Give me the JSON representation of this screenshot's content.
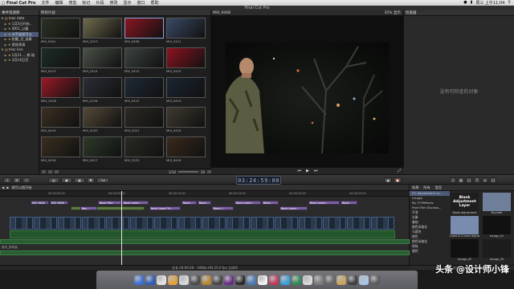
{
  "menubar": {
    "app_name": "Final Cut Pro",
    "items": [
      "文件",
      "编辑",
      "修剪",
      "标记",
      "片段",
      "修改",
      "显示",
      "窗口",
      "帮助"
    ],
    "clock": "周三 上午11:04"
  },
  "window_title": "Final Cut Pro",
  "libraries": {
    "header": "事件资源库",
    "items": [
      {
        "label": "mac data",
        "indent": 0,
        "selected": false
      },
      {
        "label": "1月5日开始...",
        "indent": 1,
        "selected": false
      },
      {
        "label": "IDO1_以看",
        "indent": 1,
        "selected": false
      },
      {
        "label": "对不起就可以",
        "indent": 1,
        "selected": true
      },
      {
        "label": "拍摄_活_准素",
        "indent": 1,
        "selected": false
      },
      {
        "label": "直接表演",
        "indent": 1,
        "selected": false
      },
      {
        "label": "mac lion",
        "indent": 0,
        "selected": false
      },
      {
        "label": "1月21..., 都 碰",
        "indent": 1,
        "selected": false
      },
      {
        "label": "3月14日活",
        "indent": 1,
        "selected": false
      }
    ]
  },
  "browser": {
    "header": "所有片段",
    "clips": [
      {
        "name": "MVI_9401",
        "bg": "#2b3324"
      },
      {
        "name": "MVI_2013",
        "bg": "#6f6b4e"
      },
      {
        "name": "MVI_9408",
        "bg": "#8a1622"
      },
      {
        "name": "MVI_2411",
        "bg": "#3a4a66"
      },
      {
        "name": "MVI_9413",
        "bg": "#1d2c27"
      },
      {
        "name": "MVI_2414",
        "bg": "#4a5248"
      },
      {
        "name": "MVI_9412",
        "bg": "#3b4440"
      },
      {
        "name": "MVI_9415",
        "bg": "#8d1320"
      },
      {
        "name": "IMG_9418",
        "bg": "#9a1a28"
      },
      {
        "name": "MVI_2016",
        "bg": "#2a2f36"
      },
      {
        "name": "MVI_9412",
        "bg": "#1f2a36"
      },
      {
        "name": "MVI_9413",
        "bg": "#1b2633"
      },
      {
        "name": "MVI_9419",
        "bg": "#3c2f22"
      },
      {
        "name": "MVI_2020",
        "bg": "#554a38"
      },
      {
        "name": "MVI_2021",
        "bg": "#2d2a24"
      },
      {
        "name": "MVI_9419",
        "bg": "#3f3a30"
      },
      {
        "name": "MVI_9416",
        "bg": "#3a2f1f"
      },
      {
        "name": "MVI_9417",
        "bg": "#2e3a2a"
      },
      {
        "name": "MVI_2022",
        "bg": "#2a2a22"
      },
      {
        "name": "MVI_9419",
        "bg": "#3a2a1c"
      }
    ],
    "footer": {
      "count": "1/14",
      "size": "30"
    }
  },
  "viewer": {
    "clip_name": "MVI_9408",
    "zoom": "35%",
    "view_label": "显示"
  },
  "inspector": {
    "header": "检查器",
    "empty_text": "没有可检查的对象"
  },
  "toolbar": {
    "timecode": "03:24:59:00"
  },
  "timeline": {
    "project": "就可以就开始",
    "ruler_ticks": [
      "00:00:00:00",
      "00:00:05:00",
      "00:00:10:00",
      "00:00:15:00",
      "00:00:20:00",
      "00:00:25:00",
      "00:00:30:00"
    ],
    "connected_clips": [
      {
        "name": "MVI_9406",
        "color": "#6a5a8a"
      },
      {
        "name": "MVI_9408",
        "color": "#6a5a8a"
      }
    ],
    "title_clips": [
      "Bas...",
      "Basic Title",
      "Basic Lower...",
      "Basic Lower Th...",
      "Basic...",
      "Basic...",
      "Basic L...",
      "Basic Lower...",
      "Basic...",
      "Basic Lower...",
      "Basic Lower...",
      "Basic..."
    ],
    "audio_label": "音乐_好听曲",
    "status": "总长 04:00:28 - 1080p HD 25.0 fps 立体声"
  },
  "effects": {
    "header": "效果",
    "tabs": [
      "所有",
      "类型"
    ],
    "categories": [
      "CC Adjustment La...",
      "mLogo",
      "My FCPeffects",
      "Pixel Film Studios...",
      "平滑",
      "光晕",
      "基础",
      "颜色风格化",
      "马赛克",
      "颜色",
      "颜色风格化",
      "原始",
      "键控"
    ],
    "tiles": [
      {
        "name": "Blank Adjustment",
        "bg": "#1e1e1e",
        "label": "Blank Adjustment Layer"
      },
      {
        "name": "Keynote",
        "bg": "#6f7f99",
        "label": ""
      },
      {
        "name": "Luma & Curves Adjustment",
        "bg": "#7a8bb0",
        "label": ""
      },
      {
        "name": "mLogo_01",
        "bg": "#111111",
        "label": ""
      },
      {
        "name": "mLogo_02",
        "bg": "#111111",
        "label": ""
      },
      {
        "name": "mLogo_03",
        "bg": "#1c1c1c",
        "label": ""
      }
    ],
    "footer": "377 项"
  },
  "dock": {
    "icons": [
      "#3a6fd8",
      "#2b5dbd",
      "#e4e4e4",
      "#e6a132",
      "#d8d8d8",
      "#4a4a4a",
      "#b7862f",
      "#444444",
      "#6a2b85",
      "#2a2a2a",
      "#4c7ab3",
      "#f2f2f2",
      "#c23b5b",
      "#3aa0db",
      "#2e8b57",
      "#d9d9d9",
      "#7a7a7a",
      "#666666",
      "#c9a35a",
      "#3e3e3e",
      "#a8c7e8",
      "#5a5a5a"
    ]
  },
  "watermark": "头条 @设计师小锋"
}
